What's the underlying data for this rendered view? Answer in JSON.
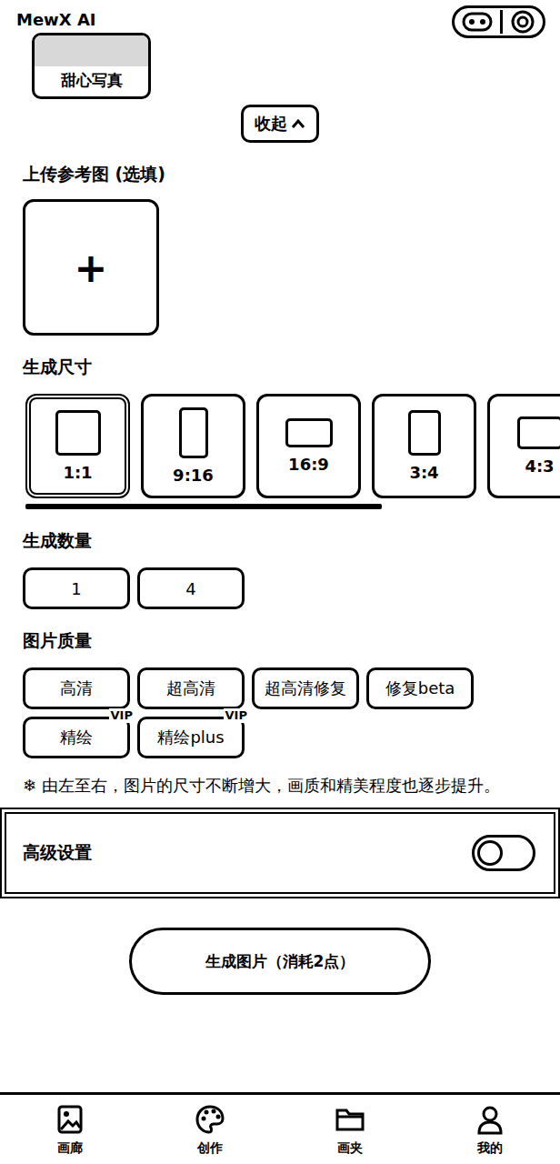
{
  "app": {
    "title": "MewX AI"
  },
  "style_card": {
    "label": "甜心写真"
  },
  "collapse_button": {
    "label": "收起"
  },
  "upload": {
    "label": "上传参考图 (选填)",
    "icon": "+"
  },
  "size": {
    "label": "生成尺寸",
    "options": [
      {
        "label": "1:1",
        "selected": true,
        "kind": "square"
      },
      {
        "label": "9:16",
        "selected": false,
        "kind": "tall"
      },
      {
        "label": "16:9",
        "selected": false,
        "kind": "wide"
      },
      {
        "label": "3:4",
        "selected": false,
        "kind": "portrait"
      },
      {
        "label": "4:3",
        "selected": false,
        "kind": "landscape"
      }
    ],
    "scroll_level": 0.7
  },
  "count": {
    "label": "生成数量",
    "options": [
      {
        "label": "1",
        "selected": false
      },
      {
        "label": "4",
        "selected": false
      }
    ]
  },
  "quality": {
    "label": "图片质量",
    "options": [
      {
        "label": "高清",
        "selected": false
      },
      {
        "label": "超高清",
        "selected": false
      },
      {
        "label": "超高清修复",
        "selected": false
      },
      {
        "label": "修复beta",
        "selected": false
      },
      {
        "label": "精绘",
        "selected": false,
        "badge": "VIP"
      },
      {
        "label": "精绘plus",
        "selected": false,
        "badge": "VIP"
      }
    ]
  },
  "note": {
    "icon": "❄",
    "text": "由左至右，图片的尺寸不断增大，画质和精美程度也逐步提升。"
  },
  "advanced": {
    "label": "高级设置",
    "on": false
  },
  "generate_button": {
    "label": "生成图片（消耗2点）"
  },
  "nav": [
    {
      "label": "画廊",
      "selected": false,
      "kind": "gallery"
    },
    {
      "label": "创作",
      "selected": false,
      "kind": "create"
    },
    {
      "label": "画夹",
      "selected": false,
      "kind": "folder"
    },
    {
      "label": "我的",
      "selected": false,
      "kind": "profile"
    }
  ]
}
